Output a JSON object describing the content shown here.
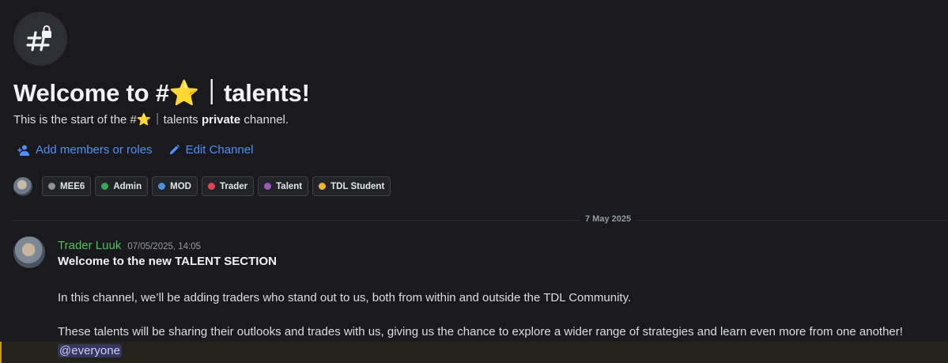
{
  "channel": {
    "icon": "hash-lock-icon",
    "welcome_title": "Welcome to #⭐｜talents!",
    "start_text_prefix": "This is the start of the #⭐｜talents ",
    "start_text_bold": "private",
    "start_text_suffix": " channel."
  },
  "actions": [
    {
      "label": "Add members or roles",
      "icon": "add-members-icon"
    },
    {
      "label": "Edit Channel",
      "icon": "pencil-icon"
    }
  ],
  "roles": [
    {
      "label": "MEE6",
      "color": "#8e9297"
    },
    {
      "label": "Admin",
      "color": "#3ba55d"
    },
    {
      "label": "MOD",
      "color": "#4a90e2"
    },
    {
      "label": "Trader",
      "color": "#e84057"
    },
    {
      "label": "Talent",
      "color": "#9b59b6"
    },
    {
      "label": "TDL Student",
      "color": "#f0b232"
    }
  ],
  "divider": {
    "date": "7 May 2025"
  },
  "message": {
    "author": "Trader Luuk",
    "author_color": "#4fc25c",
    "timestamp": "07/05/2025, 14:05",
    "heading": "Welcome to the new TALENT SECTION",
    "paragraph1": "In this channel, we’ll be adding traders who stand out to us, both from within and outside the TDL Community.",
    "paragraph2": "These talents will be sharing their outlooks and trades with us, giving us the chance to explore a wider range of strategies and learn even more from one another!",
    "mention": "@everyone"
  }
}
